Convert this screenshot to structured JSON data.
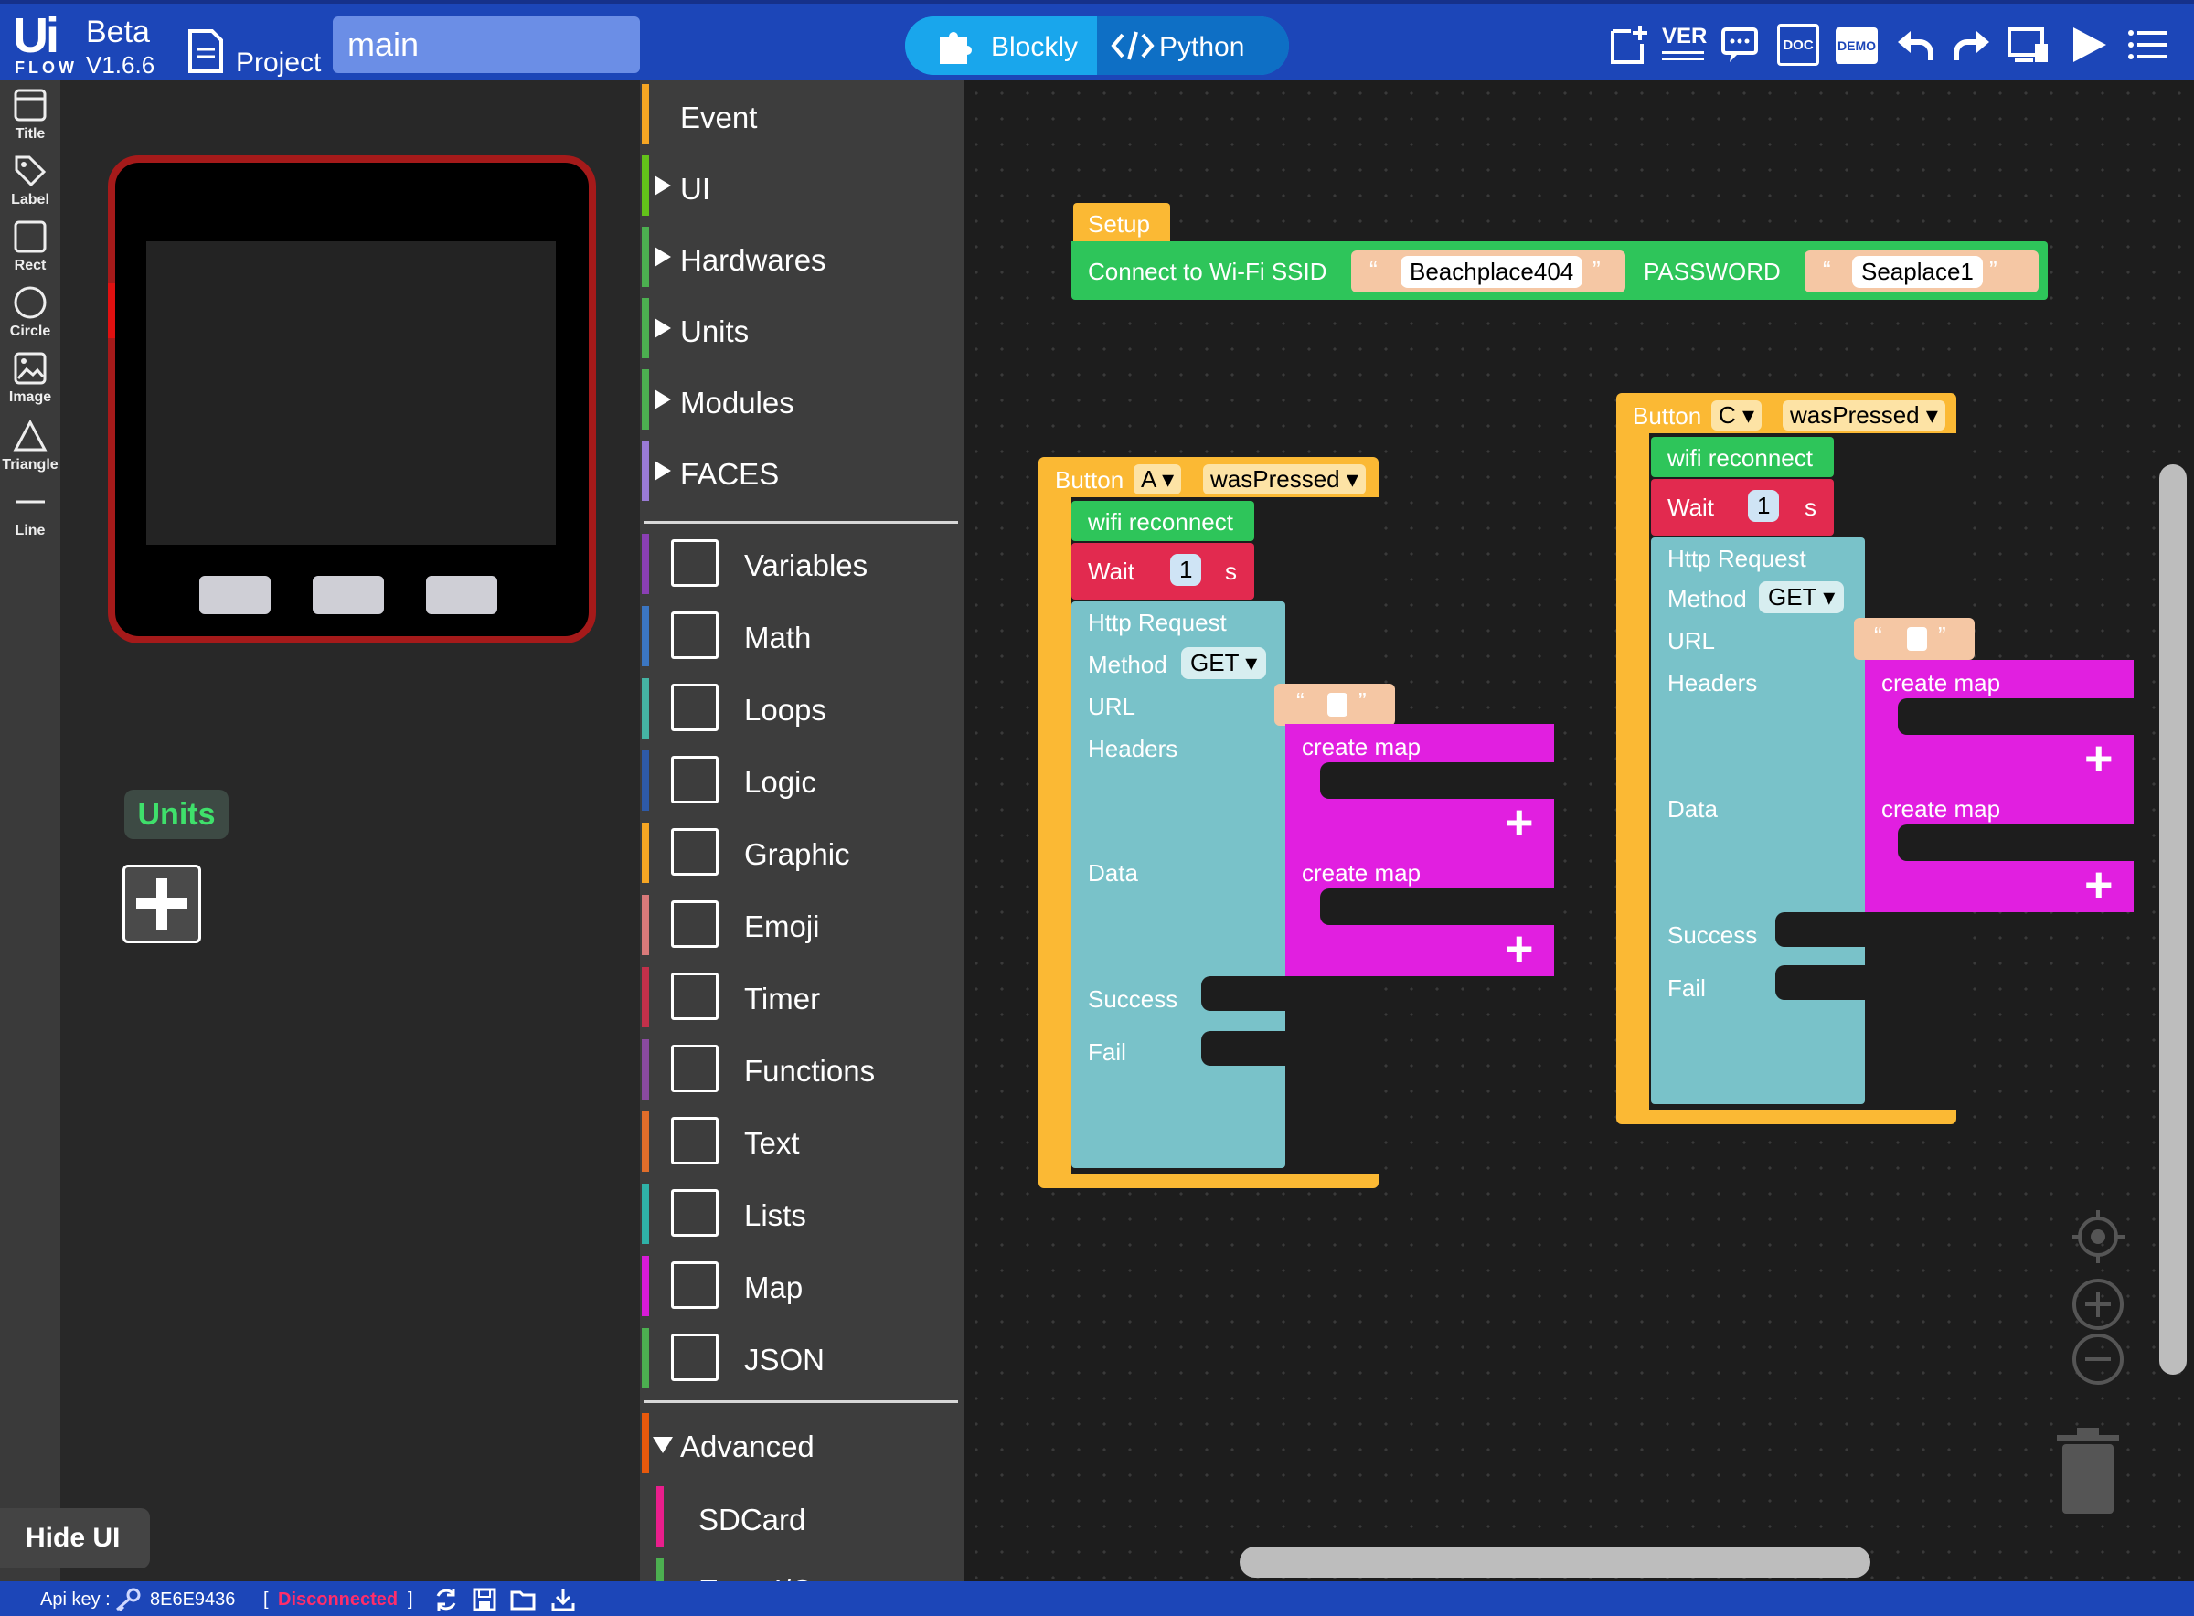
{
  "header": {
    "logo_ui": "Ui",
    "logo_flow": "FLOW",
    "beta": "Beta",
    "version": "V1.6.6",
    "project_label": "Project",
    "filename": "main",
    "mode_blockly": "Blockly",
    "mode_python": "Python",
    "icons": [
      "new-file-icon",
      "version-icon",
      "comment-icon",
      "doc-icon",
      "demo-icon",
      "undo-icon",
      "redo-icon",
      "device-icon",
      "run-icon",
      "menu-icon"
    ],
    "doc_text": "DOC",
    "demo_text": "DEMO",
    "ver_text": "VER"
  },
  "tools": [
    {
      "label": "Title",
      "icon": "title-icon"
    },
    {
      "label": "Label",
      "icon": "label-icon"
    },
    {
      "label": "Rect",
      "icon": "rect-icon"
    },
    {
      "label": "Circle",
      "icon": "circle-icon"
    },
    {
      "label": "Image",
      "icon": "image-icon"
    },
    {
      "label": "Triangle",
      "icon": "triangle-icon"
    },
    {
      "label": "Line",
      "icon": "line-icon"
    }
  ],
  "device_panel": {
    "units_label": "Units",
    "hide_ui": "Hide UI"
  },
  "categories": {
    "top": [
      {
        "label": "Event",
        "color": "#f6a623"
      },
      {
        "label": "UI",
        "color": "#63c21a"
      },
      {
        "label": "Hardwares",
        "color": "#4caf50"
      },
      {
        "label": "Units",
        "color": "#4caf50"
      },
      {
        "label": "Modules",
        "color": "#4caf50"
      },
      {
        "label": "FACES",
        "color": "#9a7bd6"
      }
    ],
    "blocks": [
      {
        "label": "Variables",
        "color": "#8a3fb4"
      },
      {
        "label": "Math",
        "color": "#3b76c2"
      },
      {
        "label": "Loops",
        "color": "#45b3a3"
      },
      {
        "label": "Logic",
        "color": "#2e5aa8"
      },
      {
        "label": "Graphic",
        "color": "#f6a623"
      },
      {
        "label": "Emoji",
        "color": "#d97a7a"
      },
      {
        "label": "Timer",
        "color": "#c2304a"
      },
      {
        "label": "Functions",
        "color": "#8a4aa0"
      },
      {
        "label": "Text",
        "color": "#e06d2a"
      },
      {
        "label": "Lists",
        "color": "#2fb2a8"
      },
      {
        "label": "Map",
        "color": "#d81bd8"
      },
      {
        "label": "JSON",
        "color": "#4caf50"
      }
    ],
    "advanced": {
      "label": "Advanced",
      "color": "#e8590c"
    },
    "advanced_items": [
      {
        "label": "SDCard",
        "color": "#e91e8c"
      },
      {
        "label": "Easy I/O",
        "color": "#4caf50"
      }
    ]
  },
  "workspace": {
    "setup": {
      "hat": "Setup",
      "connect": "Connect to Wi-Fi SSID",
      "ssid": "Beachplace404",
      "password_label": "PASSWORD",
      "password": "Seaplace1",
      "quote_open": "“",
      "quote_close": "”"
    },
    "button_a": {
      "button": "Button",
      "key": "A",
      "event": "wasPressed",
      "wifi": "wifi  reconnect",
      "wait": "Wait",
      "wait_val": "1",
      "wait_unit": "s",
      "http": "Http Request",
      "method_label": "Method",
      "method": "GET",
      "url": "URL",
      "headers": "Headers",
      "data": "Data",
      "success": "Success",
      "fail": "Fail",
      "create_map_1": "create map",
      "create_map_2": "create map",
      "plus": "+"
    },
    "button_c": {
      "button": "Button",
      "key": "C",
      "event": "wasPressed",
      "wifi": "wifi  reconnect",
      "wait": "Wait",
      "wait_val": "1",
      "wait_unit": "s",
      "http": "Http Request",
      "method_label": "Method",
      "method": "GET",
      "url": "URL",
      "headers": "Headers",
      "data": "Data",
      "success": "Success",
      "fail": "Fail",
      "create_map_1": "create map",
      "create_map_2": "create map",
      "plus": "+"
    },
    "controls": [
      "recenter-icon",
      "zoom-in-icon",
      "zoom-out-icon",
      "trash-icon"
    ]
  },
  "status": {
    "api_key_label": "Api key :",
    "api_key": "8E6E9436",
    "bracket_open": "[",
    "connection": "Disconnected",
    "bracket_close": "]",
    "connection_color": "#ff2d6a"
  },
  "colors": {
    "topbar": "#1c46b8",
    "event_yellow": "#fbb934",
    "wifi_green": "#2ec55a",
    "timer_red": "#e22a4f",
    "http_teal": "#79c2c9",
    "map_magenta": "#e11fe0"
  }
}
